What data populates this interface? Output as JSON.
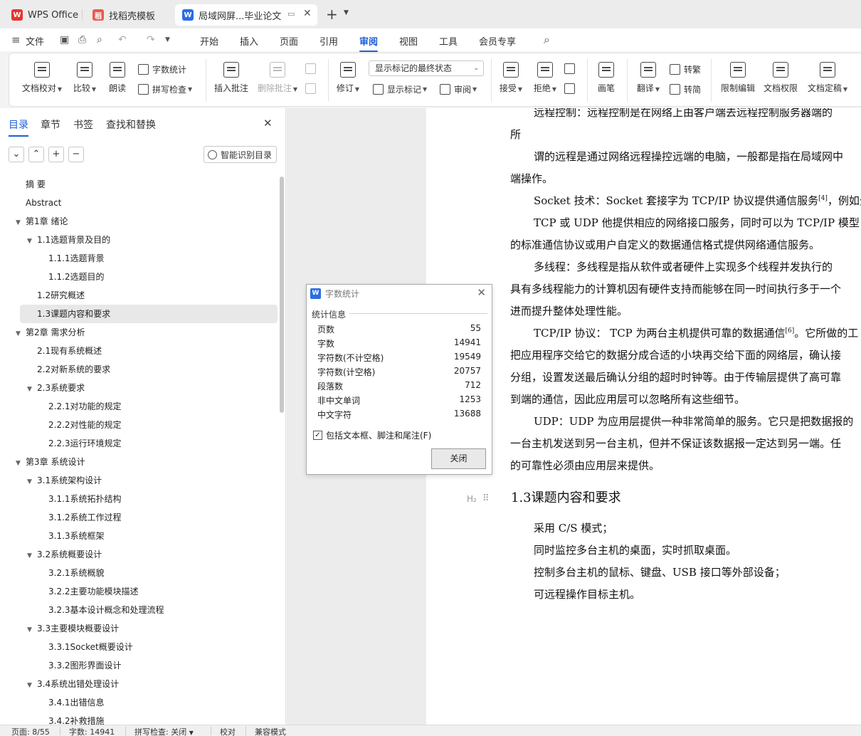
{
  "titlebar": {
    "tabs": [
      {
        "label": "WPS Office"
      },
      {
        "label": "找稻壳模板"
      },
      {
        "label": "局域网屏...毕业论文"
      }
    ],
    "new_tab": "+"
  },
  "menubar": {
    "file_label": "文件",
    "items": [
      "开始",
      "插入",
      "页面",
      "引用",
      "审阅",
      "视图",
      "工具",
      "会员专享"
    ],
    "active": "审阅"
  },
  "ribbon": {
    "doc_proof": "文档校对",
    "compare": "比较",
    "read_aloud": "朗读",
    "word_count": "字数统计",
    "spell_check": "拼写检查",
    "insert_comment": "插入批注",
    "delete_comment": "删除批注",
    "revise": "修订",
    "display_select": "显示标记的最终状态",
    "show_marks": "显示标记",
    "review": "审阅",
    "accept": "接受",
    "reject": "拒绝",
    "pen": "画笔",
    "translate": "翻译",
    "to_traditional": "转繁",
    "to_simplified": "转简",
    "restrict_edit": "限制编辑",
    "doc_permission": "文档权限",
    "doc_finalize": "文档定稿"
  },
  "leftpanel": {
    "tabs": [
      "目录",
      "章节",
      "书签",
      "查找和替换"
    ],
    "active_tab": "目录",
    "smart_toc": "智能识别目录",
    "toc": [
      {
        "label": "摘  要",
        "level": 0,
        "arrow": ""
      },
      {
        "label": "Abstract",
        "level": 0,
        "arrow": ""
      },
      {
        "label": "第1章 绪论",
        "level": 0,
        "arrow": "▼"
      },
      {
        "label": "1.1选题背景及目的",
        "level": 1,
        "arrow": "▼"
      },
      {
        "label": "1.1.1选题背景",
        "level": 2,
        "arrow": ""
      },
      {
        "label": "1.1.2选题目的",
        "level": 2,
        "arrow": ""
      },
      {
        "label": "1.2研究概述",
        "level": 1,
        "arrow": ""
      },
      {
        "label": "1.3课题内容和要求",
        "level": 1,
        "arrow": "",
        "selected": true
      },
      {
        "label": "第2章 需求分析",
        "level": 0,
        "arrow": "▼"
      },
      {
        "label": "2.1现有系统概述",
        "level": 1,
        "arrow": ""
      },
      {
        "label": "2.2对新系统的要求",
        "level": 1,
        "arrow": ""
      },
      {
        "label": "2.3系统要求",
        "level": 1,
        "arrow": "▼"
      },
      {
        "label": "2.2.1对功能的规定",
        "level": 2,
        "arrow": ""
      },
      {
        "label": "2.2.2对性能的规定",
        "level": 2,
        "arrow": ""
      },
      {
        "label": "2.2.3运行环境规定",
        "level": 2,
        "arrow": ""
      },
      {
        "label": "第3章 系统设计",
        "level": 0,
        "arrow": "▼"
      },
      {
        "label": "3.1系统架构设计",
        "level": 1,
        "arrow": "▼"
      },
      {
        "label": "3.1.1系统拓扑结构",
        "level": 2,
        "arrow": ""
      },
      {
        "label": "3.1.2系统工作过程",
        "level": 2,
        "arrow": ""
      },
      {
        "label": "3.1.3系统框架",
        "level": 2,
        "arrow": ""
      },
      {
        "label": "3.2系统概要设计",
        "level": 1,
        "arrow": "▼"
      },
      {
        "label": "3.2.1系统概貌",
        "level": 2,
        "arrow": ""
      },
      {
        "label": "3.2.2主要功能模块描述",
        "level": 2,
        "arrow": ""
      },
      {
        "label": "3.2.3基本设计概念和处理流程",
        "level": 2,
        "arrow": ""
      },
      {
        "label": "3.3主要模块概要设计",
        "level": 1,
        "arrow": "▼"
      },
      {
        "label": "3.3.1Socket概要设计",
        "level": 2,
        "arrow": ""
      },
      {
        "label": "3.3.2图形界面设计",
        "level": 2,
        "arrow": ""
      },
      {
        "label": "3.4系统出错处理设计",
        "level": 1,
        "arrow": "▼"
      },
      {
        "label": "3.4.1出错信息",
        "level": 2,
        "arrow": ""
      },
      {
        "label": "3.4.2补救措施",
        "level": 2,
        "arrow": ""
      }
    ]
  },
  "document": {
    "lines": [
      "远程控制：远程控制是在网络上由客户端去远程控制服务器端的",
      "所",
      "谓的远程是通过网络远程操控远端的电脑，一般都是指在局域网中",
      "端操作。",
      "Socket 技术：Socket 套接字为 TCP/IP 协议提供通信服务",
      "TCP 或 UDP 他提供相应的网络接口服务，同时可以为 TCP/IP 模型",
      "的标准通信协议或用户自定义的数据通信格式提供网络通信服务。",
      "多线程：多线程是指从软件或者硬件上实现多个线程并发执行的",
      "具有多线程能力的计算机因有硬件支持而能够在同一时间执行多于一个",
      "进而提升整体处理性能。",
      "TCP/IP 协议： TCP 为两台主机提供可靠的数据通信",
      "把应用程序交给它的数据分成合适的小块再交给下面的网络层，确认接",
      "分组，设置发送最后确认分组的超时时钟等。由于传输层提供了高可靠",
      "到端的通信，因此应用层可以忽略所有这些细节。",
      "UDP：UDP 为应用层提供一种非常简单的服务。它只是把数据报的",
      "一台主机发送到另一台主机，但并不保证该数据报一定达到另一端。任",
      "的可靠性必须由应用层来提供。"
    ],
    "line4_suffix": "，例如分",
    "line10_suffix": "。它所做的工",
    "ref4": "[4]",
    "ref6": "[6]",
    "heading_marker": "H₂",
    "heading": "1.3课题内容和要求",
    "items": [
      "采用 C/S 模式；",
      "同时监控多台主机的桌面，实时抓取桌面。",
      "控制多台主机的鼠标、键盘、USB 接口等外部设备；",
      "可远程操作目标主机。"
    ]
  },
  "dialog": {
    "title": "字数统计",
    "section": "统计信息",
    "rows": [
      {
        "label": "页数",
        "value": "55"
      },
      {
        "label": "字数",
        "value": "14941"
      },
      {
        "label": "字符数(不计空格)",
        "value": "19549"
      },
      {
        "label": "字符数(计空格)",
        "value": "20757"
      },
      {
        "label": "段落数",
        "value": "712"
      },
      {
        "label": "非中文单词",
        "value": "1253"
      },
      {
        "label": "中文字符",
        "value": "13688"
      }
    ],
    "include_label": "包括文本框、脚注和尾注(F)",
    "close_label": "关闭"
  },
  "statusbar": {
    "page": "页面: 8/55",
    "words": "字数: 14941",
    "spell": "拼写检查: 关闭",
    "proof": "校对",
    "compat": "兼容模式"
  }
}
